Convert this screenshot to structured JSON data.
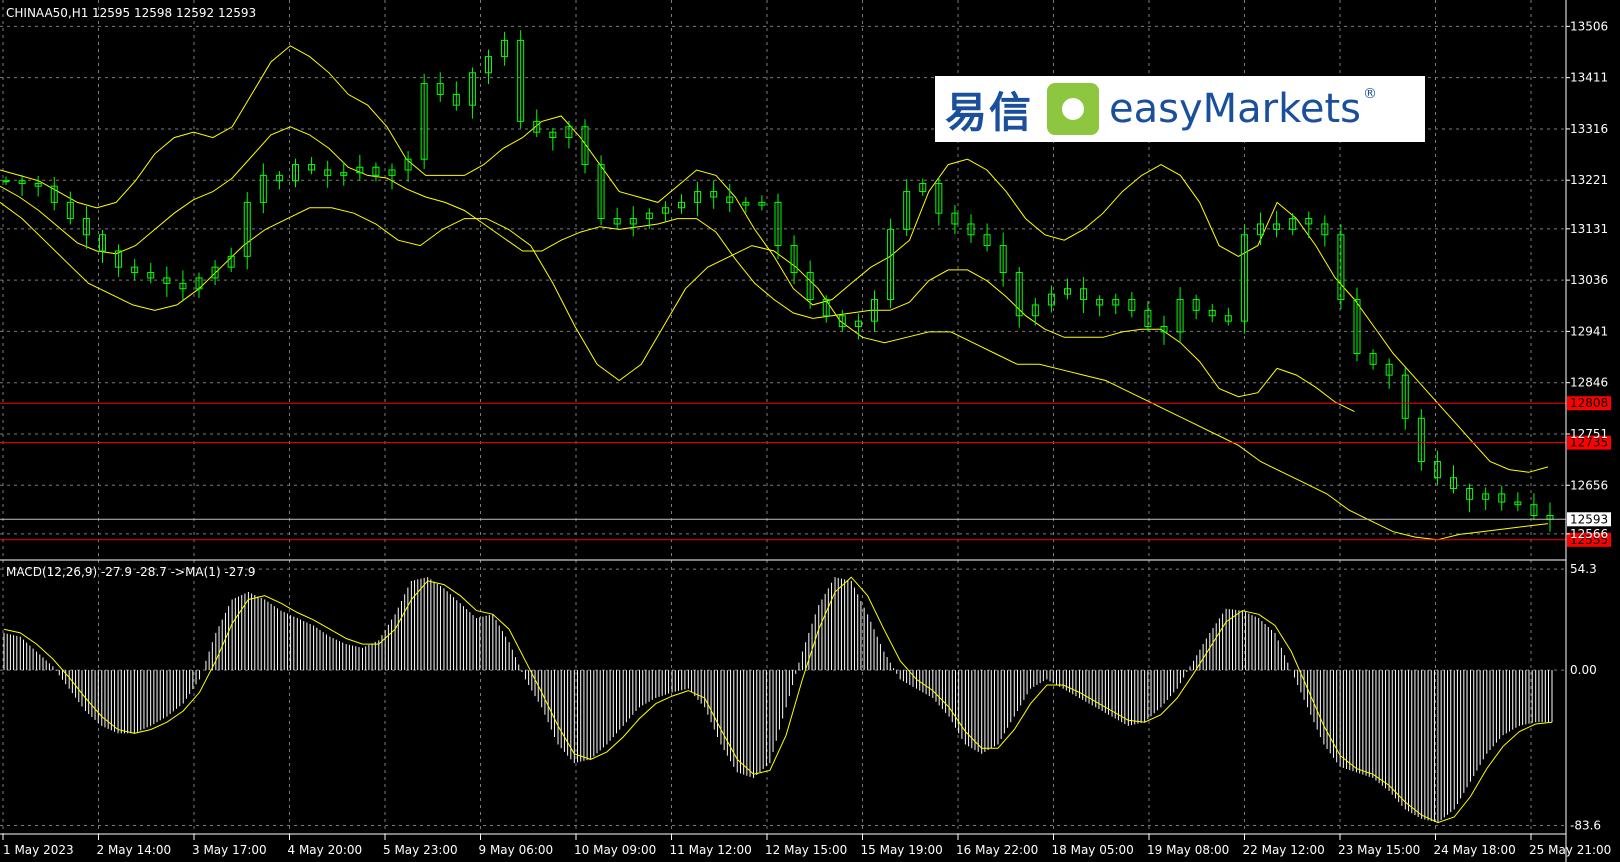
{
  "header": {
    "symbol_label": "CHINAA50,H1",
    "ohlc": "12595 12598 12592 12593",
    "macd_label": "MACD(12,26,9) -27.9 -28.7 ->MA(1) -27.9"
  },
  "logo": {
    "cn": "易信",
    "en": "easyMarkets",
    "reg": "®"
  },
  "colors": {
    "background": "#000000",
    "grid": "#7a7a7a",
    "candles": "#00ff00",
    "bollinger": "#ffff00",
    "macd_hist": "#ffffff",
    "macd_signal": "#ffff00",
    "level_line": "#ff0000",
    "axis_text": "#ffffff"
  },
  "chart_data": [
    {
      "type": "candlestick",
      "title": "CHINAA50,H1",
      "ylim": [
        12525,
        13540
      ],
      "y_ticks": [
        13506,
        13411,
        13316,
        13221,
        13131,
        13036,
        12941,
        12846,
        12751,
        12656,
        12566
      ],
      "x_ticks": [
        "1 May 2023",
        "2 May 14:00",
        "3 May 17:00",
        "4 May 20:00",
        "5 May 23:00",
        "9 May 06:00",
        "10 May 09:00",
        "11 May 12:00",
        "12 May 15:00",
        "15 May 19:00",
        "16 May 22:00",
        "18 May 05:00",
        "19 May 08:00",
        "22 May 12:00",
        "23 May 15:00",
        "24 May 18:00",
        "25 May 21:00"
      ],
      "series": {
        "close": [
          13220,
          13215,
          13210,
          13180,
          13150,
          13120,
          13090,
          13060,
          13050,
          13040,
          13030,
          13020,
          13040,
          13060,
          13080,
          13180,
          13230,
          13220,
          13250,
          13240,
          13230,
          13235,
          13245,
          13230,
          13240,
          13260,
          13400,
          13380,
          13360,
          13420,
          13450,
          13480,
          13330,
          13310,
          13300,
          13320,
          13250,
          13150,
          13140,
          13150,
          13160,
          13170,
          13180,
          13200,
          13190,
          13180,
          13175,
          13180,
          13100,
          13050,
          13000,
          12970,
          12950,
          12960,
          13000,
          13130,
          13200,
          13215,
          13160,
          13140,
          13120,
          13100,
          13050,
          12970,
          12990,
          13010,
          13020,
          13000,
          12990,
          13000,
          12980,
          12950,
          12940,
          13000,
          12980,
          12970,
          12960,
          13120,
          13140,
          13130,
          13150,
          13140,
          13120,
          13000,
          12900,
          12880,
          12860,
          12780,
          12700,
          12670,
          12650,
          12630,
          12640,
          12625,
          12620,
          12600,
          12593
        ],
        "bollinger_upper": [
          13240,
          13230,
          13220,
          13200,
          13180,
          13170,
          13180,
          13220,
          13270,
          13300,
          13310,
          13300,
          13320,
          13380,
          13440,
          13470,
          13450,
          13420,
          13380,
          13360,
          13320,
          13260,
          13230,
          13230,
          13230,
          13250,
          13280,
          13300,
          13330,
          13340,
          13300,
          13250,
          13200,
          13190,
          13180,
          13210,
          13240,
          13230,
          13190,
          13130,
          13080,
          13020,
          12990,
          13000,
          13030,
          13060,
          13080,
          13110,
          13200,
          13250,
          13260,
          13240,
          13200,
          13150,
          13120,
          13110,
          13130,
          13160,
          13200,
          13230,
          13250,
          13230,
          13180,
          13100,
          13080,
          13100,
          13180,
          13150,
          13100,
          13040,
          13000,
          12950,
          12900,
          12860,
          12820,
          12780,
          12740,
          12700,
          12685,
          12680,
          12690
        ],
        "bollinger_lower": [
          13180,
          13150,
          13110,
          13070,
          13030,
          13010,
          12990,
          12980,
          12990,
          13020,
          13060,
          13100,
          13130,
          13150,
          13170,
          13170,
          13160,
          13140,
          13110,
          13100,
          13130,
          13150,
          13150,
          13130,
          13100,
          13030,
          12950,
          12880,
          12850,
          12880,
          12950,
          13020,
          13060,
          13080,
          13100,
          13090,
          13060,
          13020,
          12960,
          12930,
          12920,
          12930,
          12940,
          12940,
          12920,
          12900,
          12880,
          12880,
          12870,
          12860,
          12850,
          12830,
          12810,
          12790,
          12770,
          12750,
          12730,
          12700,
          12680,
          12660,
          12640,
          12610,
          12590,
          12570,
          12560,
          12555,
          12565,
          12570,
          12575,
          12580,
          12585
        ]
      },
      "levels": [
        {
          "value": 12808,
          "label": "12808"
        },
        {
          "value": 12735,
          "label": "12735"
        },
        {
          "value": 12555,
          "label": "12555"
        }
      ],
      "current_price": {
        "value": 12593,
        "label": "12593"
      }
    },
    {
      "type": "bar",
      "title": "MACD(12,26,9) -27.9 -28.7 ->MA(1) -27.9",
      "ylim": [
        -86,
        56
      ],
      "y_ticks": [
        54.3,
        0.0,
        -83.6
      ],
      "y_tick_labels": [
        "54.3",
        "0.00",
        "-83.6"
      ],
      "x_ticks": [
        "1 May 2023",
        "2 May 14:00",
        "3 May 17:00",
        "4 May 20:00",
        "5 May 23:00",
        "9 May 06:00",
        "10 May 09:00",
        "11 May 12:00",
        "12 May 15:00",
        "15 May 19:00",
        "16 May 22:00",
        "18 May 05:00",
        "19 May 08:00",
        "22 May 12:00",
        "23 May 15:00",
        "24 May 18:00",
        "25 May 21:00"
      ],
      "series": [
        {
          "values": [
            20,
            18,
            10,
            2,
            -10,
            -22,
            -30,
            -34,
            -34,
            -30,
            -25,
            -18,
            -5,
            20,
            38,
            42,
            38,
            32,
            28,
            24,
            18,
            14,
            12,
            16,
            30,
            48,
            50,
            44,
            36,
            28,
            30,
            15,
            -5,
            -20,
            -40,
            -50,
            -48,
            -40,
            -30,
            -20,
            -15,
            -12,
            -10,
            -20,
            -40,
            -55,
            -58,
            -50,
            -20,
            10,
            35,
            50,
            48,
            30,
            10,
            -5,
            -10,
            -15,
            -25,
            -40,
            -45,
            -40,
            -25,
            -10,
            -5,
            -10,
            -15,
            -20,
            -25,
            -30,
            -28,
            -20,
            -10,
            5,
            20,
            33,
            32,
            28,
            20,
            0,
            -20,
            -40,
            -52,
            -55,
            -58,
            -65,
            -75,
            -80,
            -82,
            -75,
            -60,
            -45,
            -35,
            -30,
            -28,
            -28
          ]
        },
        {
          "values": [
            22,
            20,
            14,
            6,
            -4,
            -15,
            -25,
            -32,
            -34,
            -32,
            -28,
            -22,
            -12,
            5,
            25,
            38,
            40,
            36,
            31,
            27,
            22,
            17,
            14,
            14,
            22,
            38,
            48,
            46,
            40,
            32,
            30,
            22,
            5,
            -12,
            -30,
            -45,
            -48,
            -44,
            -36,
            -26,
            -18,
            -14,
            -11,
            -15,
            -32,
            -48,
            -56,
            -54,
            -35,
            -5,
            22,
            42,
            50,
            40,
            22,
            5,
            -5,
            -11,
            -20,
            -33,
            -42,
            -42,
            -32,
            -18,
            -8,
            -8,
            -12,
            -17,
            -22,
            -27,
            -28,
            -24,
            -15,
            -2,
            12,
            26,
            32,
            30,
            24,
            10,
            -10,
            -30,
            -46,
            -53,
            -56,
            -62,
            -71,
            -78,
            -82,
            -79,
            -68,
            -53,
            -41,
            -33,
            -29,
            -28
          ]
        }
      ]
    }
  ]
}
